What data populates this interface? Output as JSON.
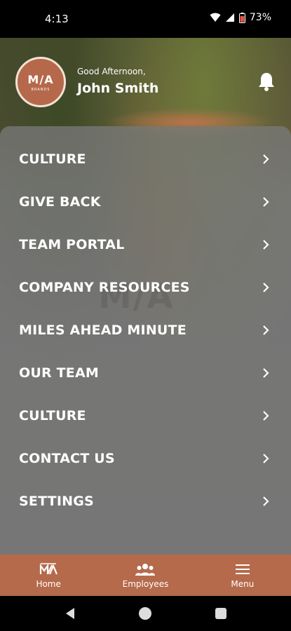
{
  "status_bar": {
    "time": "4:13",
    "battery_pct": "73%",
    "icons": [
      "wifi-icon",
      "signal-icon",
      "battery-icon"
    ]
  },
  "header": {
    "logo_text": "M/A",
    "logo_sub": "BRANDS",
    "greeting": "Good Afternoon,",
    "user_name": "John Smith",
    "notification_icon": "bell-icon"
  },
  "menu": {
    "items": [
      {
        "label": "CULTURE"
      },
      {
        "label": "GIVE BACK"
      },
      {
        "label": "TEAM PORTAL"
      },
      {
        "label": "COMPANY RESOURCES"
      },
      {
        "label": "MILES AHEAD MINUTE"
      },
      {
        "label": "OUR TEAM"
      },
      {
        "label": "CULTURE"
      },
      {
        "label": "CONTACT US"
      },
      {
        "label": "SETTINGS"
      }
    ],
    "chevron_icon": "chevron-right-icon"
  },
  "bottom_nav": {
    "items": [
      {
        "label": "Home",
        "icon": "ma-logo-icon"
      },
      {
        "label": "Employees",
        "icon": "people-icon"
      },
      {
        "label": "Menu",
        "icon": "hamburger-icon"
      }
    ]
  },
  "colors": {
    "accent": "#b56a4b",
    "menu_overlay": "#787878",
    "text": "#ffffff"
  }
}
